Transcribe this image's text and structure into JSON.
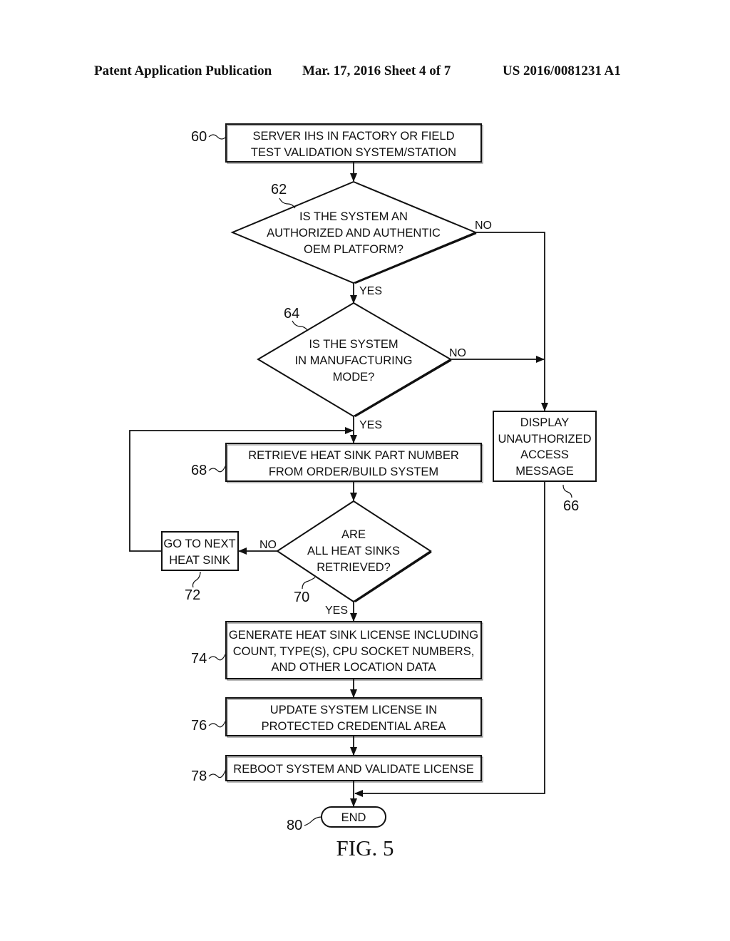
{
  "header": {
    "publication": "Patent Application Publication",
    "date_sheet": "Mar. 17, 2016  Sheet 4 of 7",
    "patent_number": "US 2016/0081231 A1"
  },
  "figure_label": "FIG. 5",
  "nodes": {
    "n60": {
      "ref": "60",
      "lines": [
        "SERVER IHS IN FACTORY OR FIELD",
        "TEST VALIDATION SYSTEM/STATION"
      ]
    },
    "n62": {
      "ref": "62",
      "lines": [
        "IS THE SYSTEM AN",
        "AUTHORIZED AND AUTHENTIC",
        "OEM PLATFORM?"
      ]
    },
    "n64": {
      "ref": "64",
      "lines": [
        "IS THE SYSTEM",
        "IN MANUFACTURING",
        "MODE?"
      ]
    },
    "n66": {
      "ref": "66",
      "lines": [
        "DISPLAY",
        "UNAUTHORIZED",
        "ACCESS",
        "MESSAGE"
      ]
    },
    "n68": {
      "ref": "68",
      "lines": [
        "RETRIEVE HEAT SINK PART NUMBER",
        "FROM ORDER/BUILD SYSTEM"
      ]
    },
    "n70": {
      "ref": "70",
      "lines": [
        "ARE",
        "ALL HEAT SINKS",
        "RETRIEVED?"
      ]
    },
    "n72": {
      "ref": "72",
      "lines": [
        "GO TO NEXT",
        "HEAT SINK"
      ]
    },
    "n74": {
      "ref": "74",
      "lines": [
        "GENERATE HEAT SINK LICENSE INCLUDING",
        "COUNT, TYPE(S), CPU SOCKET NUMBERS,",
        "AND OTHER LOCATION DATA"
      ]
    },
    "n76": {
      "ref": "76",
      "lines": [
        "UPDATE SYSTEM LICENSE IN",
        "PROTECTED CREDENTIAL AREA"
      ]
    },
    "n78": {
      "ref": "78",
      "lines": [
        "REBOOT SYSTEM AND VALIDATE LICENSE"
      ]
    },
    "n80": {
      "ref": "80",
      "lines": [
        "END"
      ]
    }
  },
  "edge_labels": {
    "e62_no": "NO",
    "e62_yes": "YES",
    "e64_no": "NO",
    "e64_yes": "YES",
    "e70_no": "NO",
    "e70_yes": "YES"
  }
}
